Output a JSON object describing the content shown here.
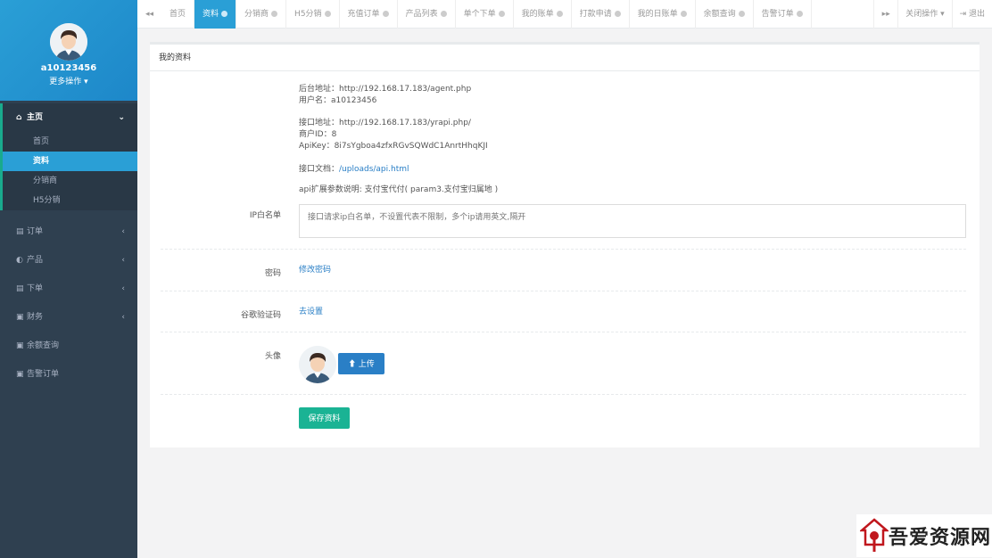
{
  "sidebar": {
    "username": "a10123456",
    "more": "更多操作 ▾",
    "home_group": {
      "icon": "home-icon",
      "label": "主页",
      "arrow": "⌄"
    },
    "home_items": [
      "首页",
      "资料",
      "分销商",
      "H5分销"
    ],
    "groups": [
      {
        "icon": "document-icon",
        "label": "订单",
        "arrow": "‹"
      },
      {
        "icon": "product-icon",
        "label": "产品",
        "arrow": "‹"
      },
      {
        "icon": "document-icon",
        "label": "下单",
        "arrow": "‹"
      },
      {
        "icon": "money-icon",
        "label": "财务",
        "arrow": "‹"
      },
      {
        "icon": "money-icon",
        "label": "余额查询",
        "arrow": ""
      },
      {
        "icon": "money-icon",
        "label": "告警订单",
        "arrow": ""
      }
    ]
  },
  "topbar": {
    "prev": "◂◂",
    "next": "▸▸",
    "tabs": [
      "首页",
      "资料",
      "分销商",
      "H5分销",
      "充值订单",
      "产品列表",
      "单个下单",
      "我的账单",
      "打款申请",
      "我的日账单",
      "余额查询",
      "告警订单"
    ],
    "active_tab": "资料",
    "close_ops": "关闭操作 ▾",
    "logout": "⇥ 退出"
  },
  "panel": {
    "title": "我的资料",
    "backend_line": "后台地址：http://192.168.17.183/agent.php",
    "user_line": "用户名：a10123456",
    "api_addr_line": "接口地址：http://192.168.17.183/yrapi.php/",
    "merchant_line": "商户ID：8",
    "apikey_line": "ApiKey：8i7sYgboa4zfxRGvSQWdC1AnrtHhqKJI",
    "doc_label": "接口文档：",
    "doc_link": "/uploads/api.html",
    "ext_line": "api扩展参数说明: 支付宝代付( param3.支付宝归属地 )",
    "ip_label": "IP白名单",
    "ip_placeholder": "接口请求ip白名单，不设置代表不限制，多个ip请用英文,隔开",
    "pwd_label": "密码",
    "pwd_link": "修改密码",
    "google_label": "谷歌验证码",
    "google_link": "去设置",
    "avatar_label": "头像",
    "upload_label": "上传",
    "save_label": "保存资料"
  },
  "watermark": {
    "text": "吾爱资源网"
  },
  "colors": {
    "sidebar": "#2f4050",
    "accent_blue": "#2a9fd6",
    "save_green": "#1ab394"
  }
}
